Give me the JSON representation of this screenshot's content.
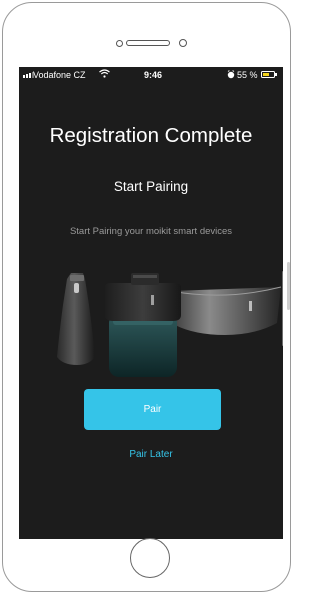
{
  "status_bar": {
    "carrier": "Vodafone CZ",
    "time": "9:46",
    "battery_percent": "55 %",
    "battery_level": 0.55,
    "icons": [
      "signal-icon",
      "wifi-icon",
      "alarm-icon",
      "battery-icon"
    ]
  },
  "screen": {
    "title": "Registration Complete",
    "subtitle": "Start Pairing",
    "description": "Start Pairing your moikit smart devices",
    "illustration": "moikit-devices-illustration"
  },
  "actions": {
    "pair_label": "Pair",
    "pair_later_label": "Pair Later"
  },
  "colors": {
    "accent": "#35c4e8",
    "screen_background": "#1c1c1c",
    "battery": "#f2d21b",
    "description_text": "#9a9a9a"
  }
}
